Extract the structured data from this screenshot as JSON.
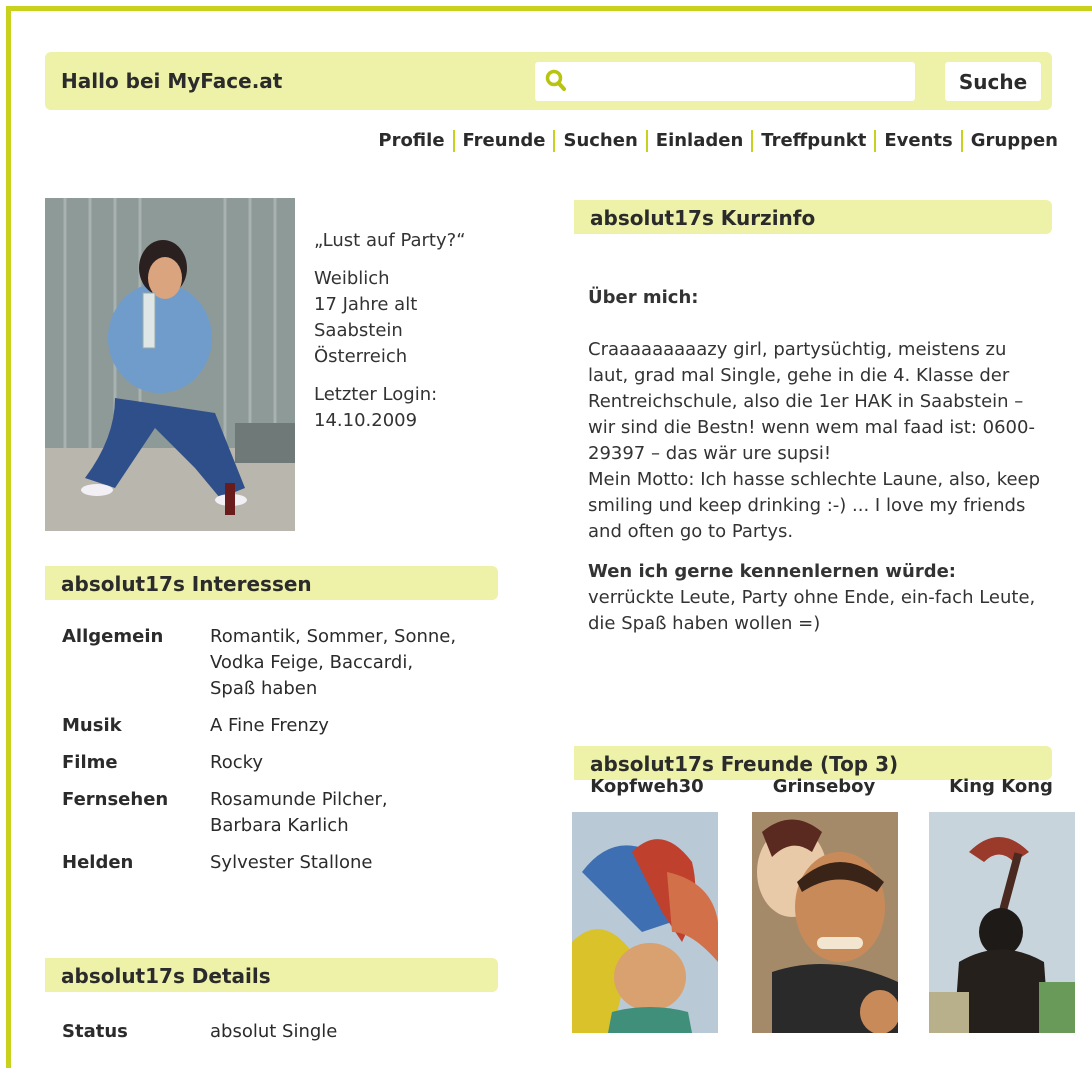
{
  "header": {
    "site_title": "Hallo bei MyFace.at",
    "search_placeholder": "",
    "search_button": "Suche"
  },
  "nav": [
    "Profile",
    "Freunde",
    "Suchen",
    "Einladen",
    "Treffpunkt",
    "Events",
    "Gruppen"
  ],
  "profile": {
    "quote": "„Lust auf Party?“",
    "gender": "Weiblich",
    "age": "17 Jahre alt",
    "city": "Saabstein",
    "country": "Österreich",
    "last_login_label": "Letzter Login:",
    "last_login_date": "14.10.2009"
  },
  "interests": {
    "heading": "absolut17s Interessen",
    "rows": [
      {
        "key": "Allgemein",
        "value": "Romantik, Sommer, Sonne, Vodka Feige, Baccardi, Spaß haben"
      },
      {
        "key": "Musik",
        "value": "A Fine Frenzy"
      },
      {
        "key": "Filme",
        "value": "Rocky"
      },
      {
        "key": "Fernsehen",
        "value": "Rosamunde Pilcher, Barbara Karlich"
      },
      {
        "key": "Helden",
        "value": "Sylvester Stallone"
      }
    ]
  },
  "details": {
    "heading": "absolut17s Details",
    "rows": [
      {
        "key": "Status",
        "value": "absolut Single"
      }
    ]
  },
  "kurzinfo": {
    "heading": "absolut17s Kurzinfo",
    "about_label": "Über mich:",
    "about_text_1": "Craaaaaaaaazy girl, partysüchtig, meistens zu laut, grad mal Single, gehe in die 4. Klasse der Rentreichschule, also die 1er HAK in Saabstein – wir sind die Bestn! wenn wem mal faad ist: 0600-29397 – das wär ure supsi!",
    "about_text_2": "Mein Motto: Ich hasse schlechte Laune, also, keep smiling und keep drinking :-) ... I love my friends and often go to Partys.",
    "meet_label": "Wen ich gerne kennenlernen würde:",
    "meet_text": "verrückte Leute, Party ohne Ende, ein-fach Leute, die Spaß haben wollen =)"
  },
  "friends": {
    "heading": "absolut17s Freunde (Top 3)",
    "items": [
      {
        "name": "Kopfweh30"
      },
      {
        "name": "Grinseboy"
      },
      {
        "name": "King Kong"
      }
    ]
  }
}
